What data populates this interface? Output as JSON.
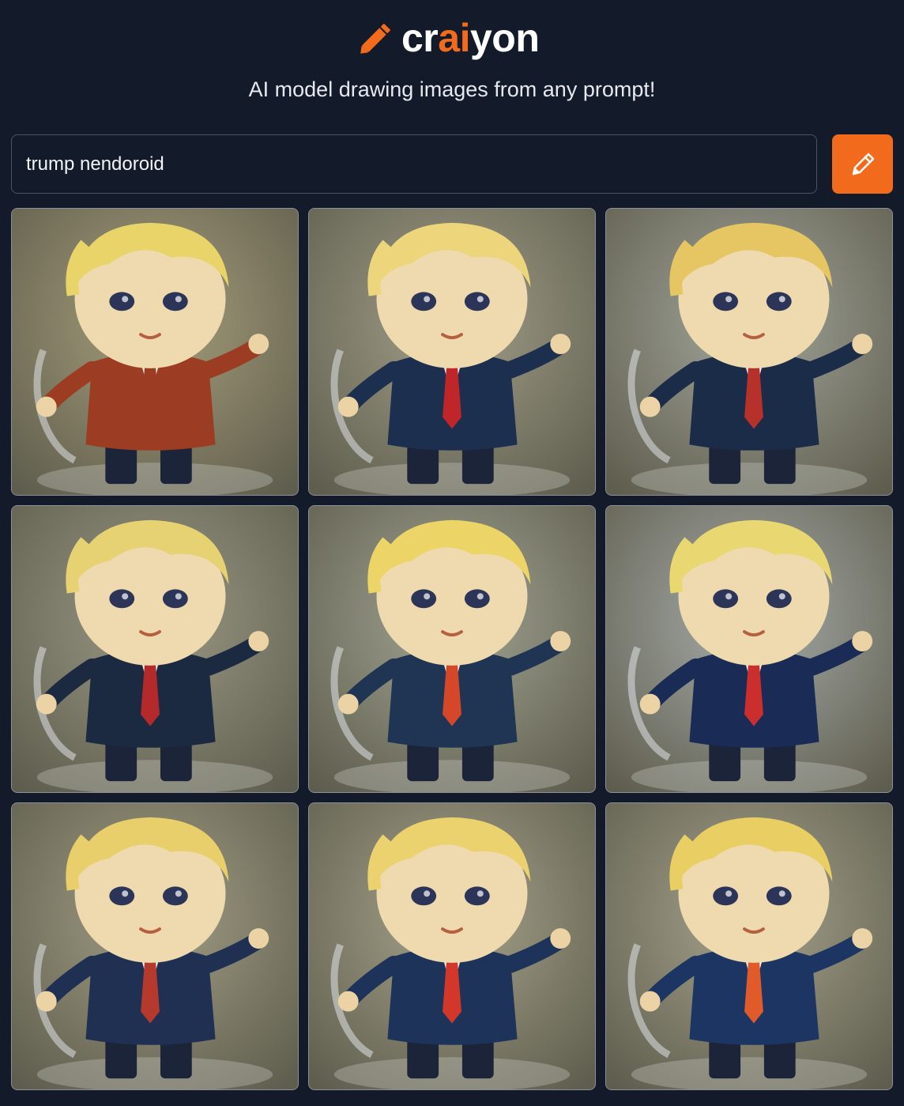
{
  "header": {
    "logo": {
      "text_before": "cr",
      "text_accent": "ai",
      "text_after": "yon",
      "icon": "pencil-icon"
    },
    "tagline": "AI model drawing images from any prompt!"
  },
  "search": {
    "value": "trump nendoroid",
    "button_icon": "pencil-icon"
  },
  "colors": {
    "background": "#131a2a",
    "accent": "#f26a1b",
    "input_border": "#4b5366"
  },
  "results": {
    "images": [
      {
        "palette": {
          "bg": "#a39b78",
          "hair": "#e9d46a",
          "suit": "#9c3c22",
          "tie": "#9c3c22"
        }
      },
      {
        "palette": {
          "bg": "#9e9c88",
          "hair": "#ecd57a",
          "suit": "#1d2f4e",
          "tie": "#c0252a"
        }
      },
      {
        "palette": {
          "bg": "#9fa49c",
          "hair": "#e6c563",
          "suit": "#1b2c48",
          "tie": "#b7302a"
        }
      },
      {
        "palette": {
          "bg": "#979583",
          "hair": "#e6d173",
          "suit": "#1c2a41",
          "tie": "#b42a2a"
        }
      },
      {
        "palette": {
          "bg": "#9ea292",
          "hair": "#ecd466",
          "suit": "#1f3553",
          "tie": "#d6472a"
        }
      },
      {
        "palette": {
          "bg": "#a5acad",
          "hair": "#e9d872",
          "suit": "#1a2c55",
          "tie": "#cc2d2d"
        }
      },
      {
        "palette": {
          "bg": "#9e9a83",
          "hair": "#e8cf6b",
          "suit": "#1f3053",
          "tie": "#b5392c"
        }
      },
      {
        "palette": {
          "bg": "#a3a18a",
          "hair": "#ecd26e",
          "suit": "#1d3359",
          "tie": "#d2372a"
        }
      },
      {
        "palette": {
          "bg": "#a3a08c",
          "hair": "#e9cf63",
          "suit": "#1c3562",
          "tie": "#e15a2a"
        }
      }
    ]
  }
}
